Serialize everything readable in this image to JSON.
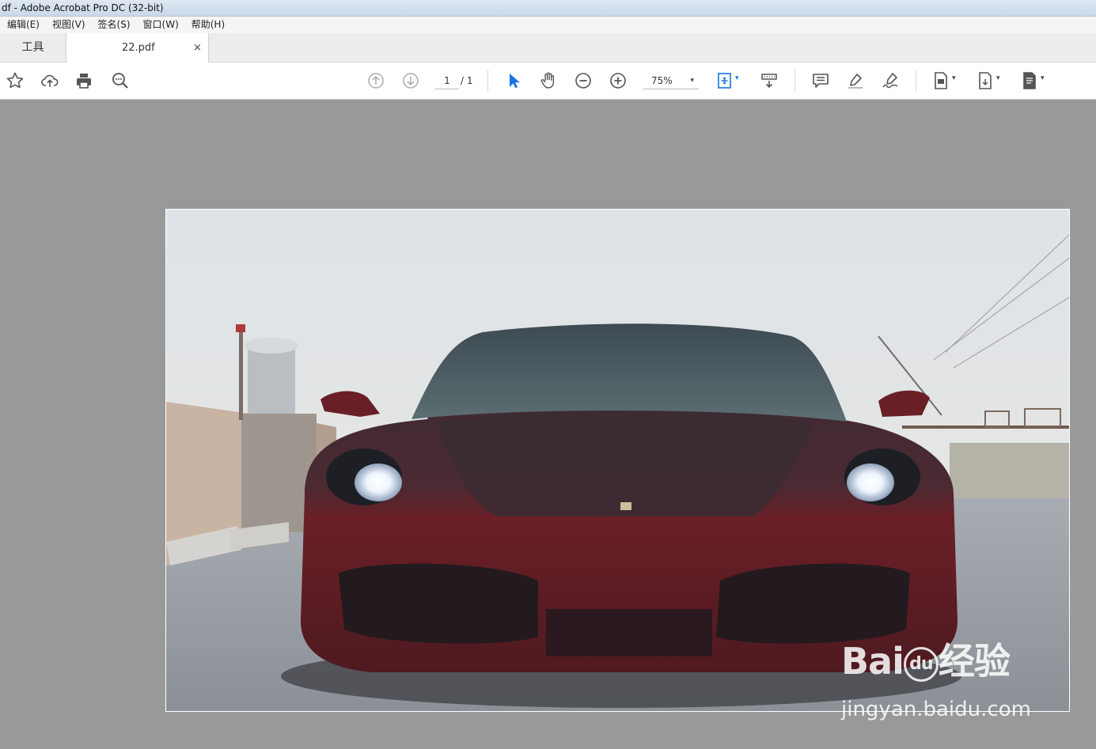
{
  "window": {
    "title": "df - Adobe Acrobat Pro DC (32-bit)"
  },
  "menu": [
    "编辑(E)",
    "视图(V)",
    "签名(S)",
    "窗口(W)",
    "帮助(H)"
  ],
  "tabs": {
    "tools": "工具",
    "document": "22.pdf",
    "close": "×"
  },
  "toolbar": {
    "page_current": "1",
    "page_total": "/ 1",
    "zoom": "75%",
    "caret": "▾"
  },
  "icons": [
    "star-icon",
    "cloud-upload-icon",
    "print-icon",
    "search-icon",
    "page-up-icon",
    "page-down-icon",
    "select-arrow-icon",
    "hand-icon",
    "zoom-out-icon",
    "zoom-in-icon",
    "fit-page-icon",
    "scroll-mode-icon",
    "comment-icon",
    "highlight-icon",
    "sign-icon",
    "save-file-icon",
    "export-file-icon",
    "more-file-icon"
  ],
  "colors": {
    "accent_blue": "#1473e6",
    "canvas": "#999999",
    "car_body": "#6a1f26"
  },
  "watermark": {
    "brand": "Bai",
    "brand2": "du",
    "cn": "经验",
    "url": "jingyan.baidu.com"
  }
}
